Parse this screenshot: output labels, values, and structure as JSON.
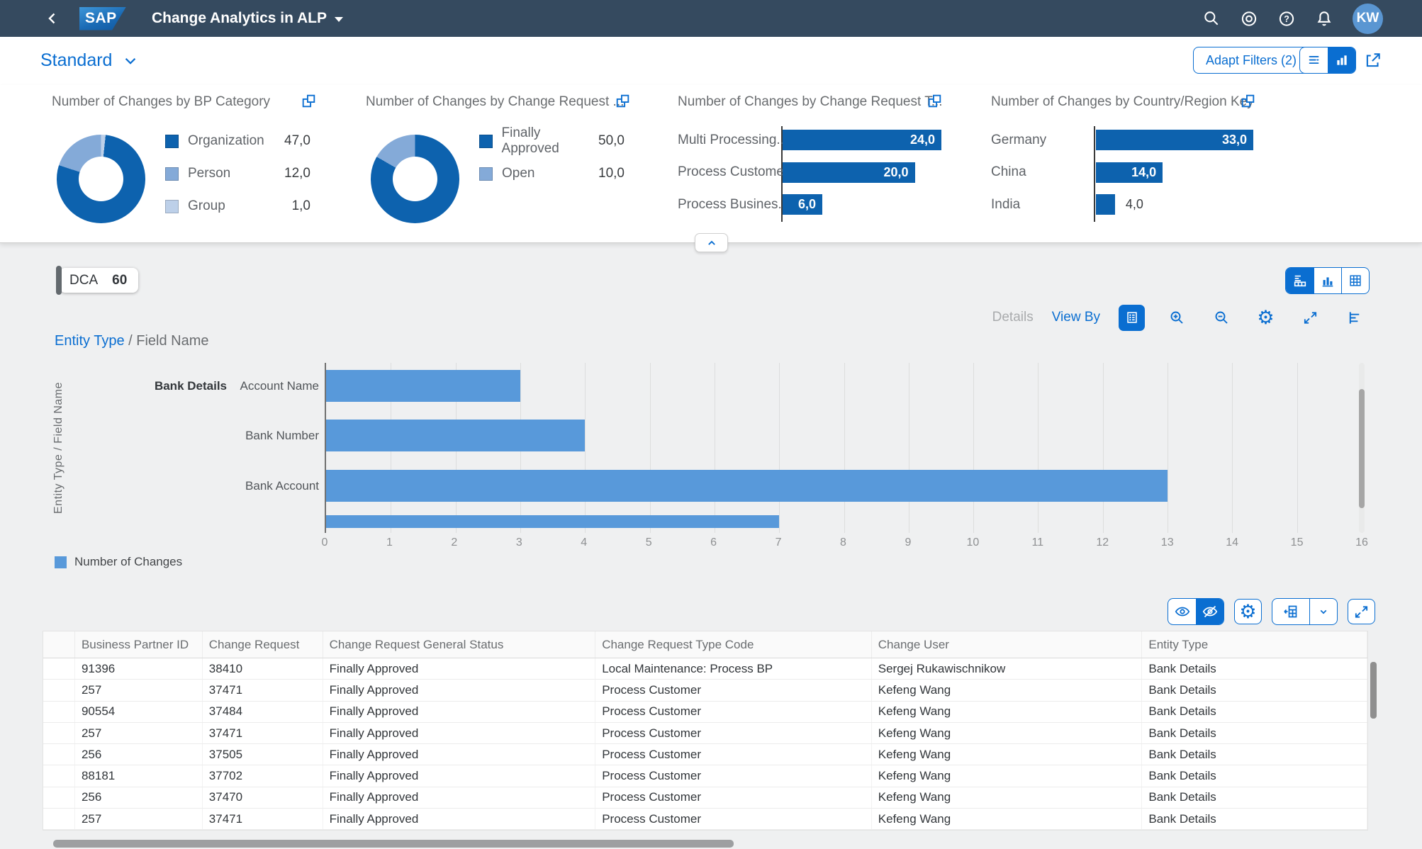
{
  "shell": {
    "title": "Change Analytics in ALP",
    "avatar_initials": "KW"
  },
  "filter_bar": {
    "variant": "Standard",
    "adapt_filters": "Adapt Filters (2)"
  },
  "palette": {
    "dark": "#0d62ae",
    "medium": "#84aad8",
    "light": "#bdd0e9",
    "bar_blue": "#5899da",
    "accent": "#0a6ed1",
    "shell_bg": "#354a5f"
  },
  "kpi_cards": [
    {
      "title": "Number of Changes by BP Category",
      "type": "donut",
      "slices": [
        {
          "color": "light",
          "from": 0,
          "to": 6
        },
        {
          "color": "dark",
          "from": 6,
          "to": 288
        },
        {
          "color": "medium",
          "from": 288,
          "to": 360
        }
      ],
      "legend": [
        {
          "label": "Organization",
          "value": "47,0",
          "color": "dark"
        },
        {
          "label": "Person",
          "value": "12,0",
          "color": "medium"
        },
        {
          "label": "Group",
          "value": "1,0",
          "color": "light"
        }
      ]
    },
    {
      "title": "Number of Changes by Change Request ...",
      "type": "donut",
      "slices": [
        {
          "color": "dark",
          "from": 0,
          "to": 300
        },
        {
          "color": "medium",
          "from": 300,
          "to": 360
        }
      ],
      "legend": [
        {
          "label": "Finally Approved",
          "value": "50,0",
          "color": "dark"
        },
        {
          "label": "Open",
          "value": "10,0",
          "color": "medium"
        }
      ]
    },
    {
      "title": "Number of Changes by Change Request T...",
      "type": "bar",
      "label_align": "right",
      "bars": [
        {
          "label": "Multi Processing...",
          "value": "24,0",
          "pct": 100
        },
        {
          "label": "Process Customer",
          "value": "20,0",
          "pct": 83.3
        },
        {
          "label": "Process Busines...",
          "value": "6,0",
          "pct": 25
        }
      ]
    },
    {
      "title": "Number of Changes by Country/Region Key",
      "type": "bar",
      "label_align": "left",
      "bars": [
        {
          "label": "Germany",
          "value": "33,0",
          "pct": 100
        },
        {
          "label": "China",
          "value": "14,0",
          "pct": 42.4
        },
        {
          "label": "India",
          "value": "4,0",
          "pct": 12.1,
          "value_outside": true
        }
      ]
    }
  ],
  "chart_section": {
    "chip": {
      "label": "DCA",
      "count": "60"
    },
    "details": "Details",
    "view_by": "View By",
    "breadcrumb_link": "Entity Type",
    "breadcrumb_rest": " / Field Name",
    "axis_title": "Entity Type / Field Name",
    "group_label": "Bank Details",
    "legend_label": "Number of Changes"
  },
  "chart_data": [
    {
      "id": "bp-category",
      "type": "pie",
      "subtype": "donut",
      "title": "Number of Changes by BP Category",
      "categories": [
        "Organization",
        "Person",
        "Group"
      ],
      "values": [
        47,
        12,
        1
      ]
    },
    {
      "id": "cr-status",
      "type": "pie",
      "subtype": "donut",
      "title": "Number of Changes by Change Request ...",
      "categories": [
        "Finally Approved",
        "Open"
      ],
      "values": [
        50,
        10
      ]
    },
    {
      "id": "cr-type",
      "type": "bar",
      "orientation": "horizontal",
      "title": "Number of Changes by Change Request T...",
      "categories": [
        "Multi Processing...",
        "Process Customer",
        "Process Busines..."
      ],
      "values": [
        24,
        20,
        6
      ]
    },
    {
      "id": "country",
      "type": "bar",
      "orientation": "horizontal",
      "title": "Number of Changes by Country/Region Key",
      "categories": [
        "Germany",
        "China",
        "India"
      ],
      "values": [
        33,
        14,
        4
      ]
    },
    {
      "id": "main",
      "type": "bar",
      "orientation": "horizontal",
      "title": "Entity Type / Field Name",
      "group_label": "Bank Details",
      "categories": [
        "Account Name",
        "Bank Number",
        "Bank Account"
      ],
      "values": [
        3,
        4,
        13
      ],
      "partial_next_value": 7,
      "xlim": [
        0,
        16
      ],
      "xticks": [
        0,
        1,
        2,
        3,
        4,
        5,
        6,
        7,
        8,
        9,
        10,
        11,
        12,
        13,
        14,
        15,
        16
      ],
      "ylabel": "Entity Type / Field Name",
      "legend": [
        "Number of Changes"
      ],
      "series_name": "Number of Changes",
      "grid": true
    }
  ],
  "table": {
    "columns": [
      "",
      "Business Partner ID",
      "Change Request",
      "Change Request General Status",
      "Change Request Type Code",
      "Change User",
      "Entity Type"
    ],
    "rows": [
      [
        "91396",
        "38410",
        "Finally Approved",
        "Local Maintenance: Process BP",
        "Sergej Rukawischnikow",
        "Bank Details"
      ],
      [
        "257",
        "37471",
        "Finally Approved",
        "Process Customer",
        "Kefeng Wang",
        "Bank Details"
      ],
      [
        "90554",
        "37484",
        "Finally Approved",
        "Process Customer",
        "Kefeng Wang",
        "Bank Details"
      ],
      [
        "257",
        "37471",
        "Finally Approved",
        "Process Customer",
        "Kefeng Wang",
        "Bank Details"
      ],
      [
        "256",
        "37505",
        "Finally Approved",
        "Process Customer",
        "Kefeng Wang",
        "Bank Details"
      ],
      [
        "88181",
        "37702",
        "Finally Approved",
        "Process Customer",
        "Kefeng Wang",
        "Bank Details"
      ],
      [
        "256",
        "37470",
        "Finally Approved",
        "Process Customer",
        "Kefeng Wang",
        "Bank Details"
      ],
      [
        "257",
        "37471",
        "Finally Approved",
        "Process Customer",
        "Kefeng Wang",
        "Bank Details"
      ]
    ]
  }
}
